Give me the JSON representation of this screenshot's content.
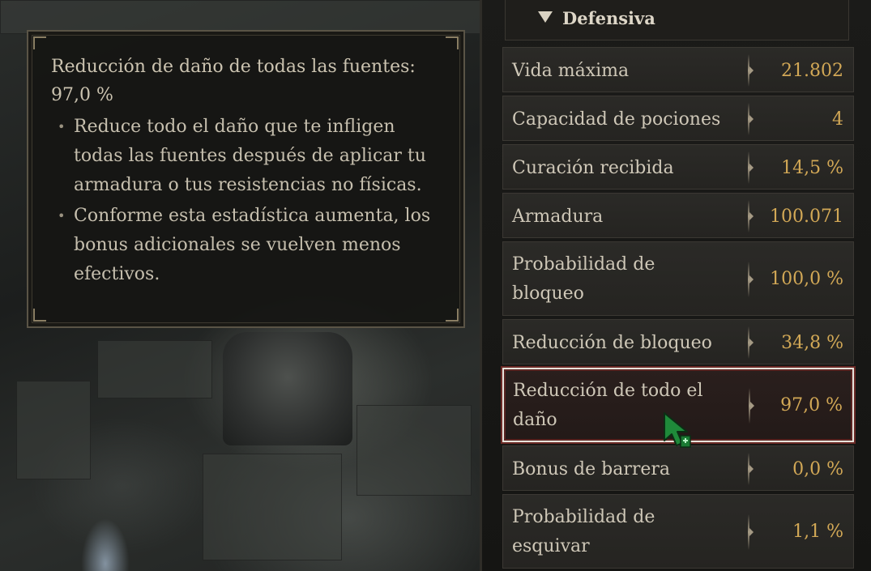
{
  "tooltip": {
    "title": "Reducción de daño de todas las fuentes: 97,0 %",
    "bullets": [
      "Reduce todo el daño que te infligen todas las fuentes después de aplicar tu armadura o tus resistencias no físicas.",
      "Conforme esta estadística aumenta, los bonus adicionales se vuelven menos efectivos."
    ]
  },
  "panel": {
    "section_title": "Defensiva",
    "stats": [
      {
        "name": "Vida máxima",
        "value": "21.802"
      },
      {
        "name": "Capacidad de pociones",
        "value": "4"
      },
      {
        "name": "Curación recibida",
        "value": "14,5 %"
      },
      {
        "name": "Armadura",
        "value": "100.071"
      },
      {
        "name": "Probabilidad de bloqueo",
        "value": "100,0 %"
      },
      {
        "name": "Reducción de bloqueo",
        "value": "34,8 %"
      },
      {
        "name": "Reducción de todo el daño",
        "value": "97,0 %"
      },
      {
        "name": "Bonus de barrera",
        "value": "0,0 %"
      },
      {
        "name": "Probabilidad de esquivar",
        "value": "1,1 %"
      }
    ],
    "selected_stat": "Reducción de todo el daño"
  },
  "colors": {
    "value_gold": "#d2a856",
    "text_light": "#cec7b7",
    "selection_border": "#e8e4dc",
    "cursor_green": "#1f8a3a"
  },
  "icons": {
    "collapse": "triangle-down-icon",
    "cursor": "mouse-pointer-icon"
  }
}
